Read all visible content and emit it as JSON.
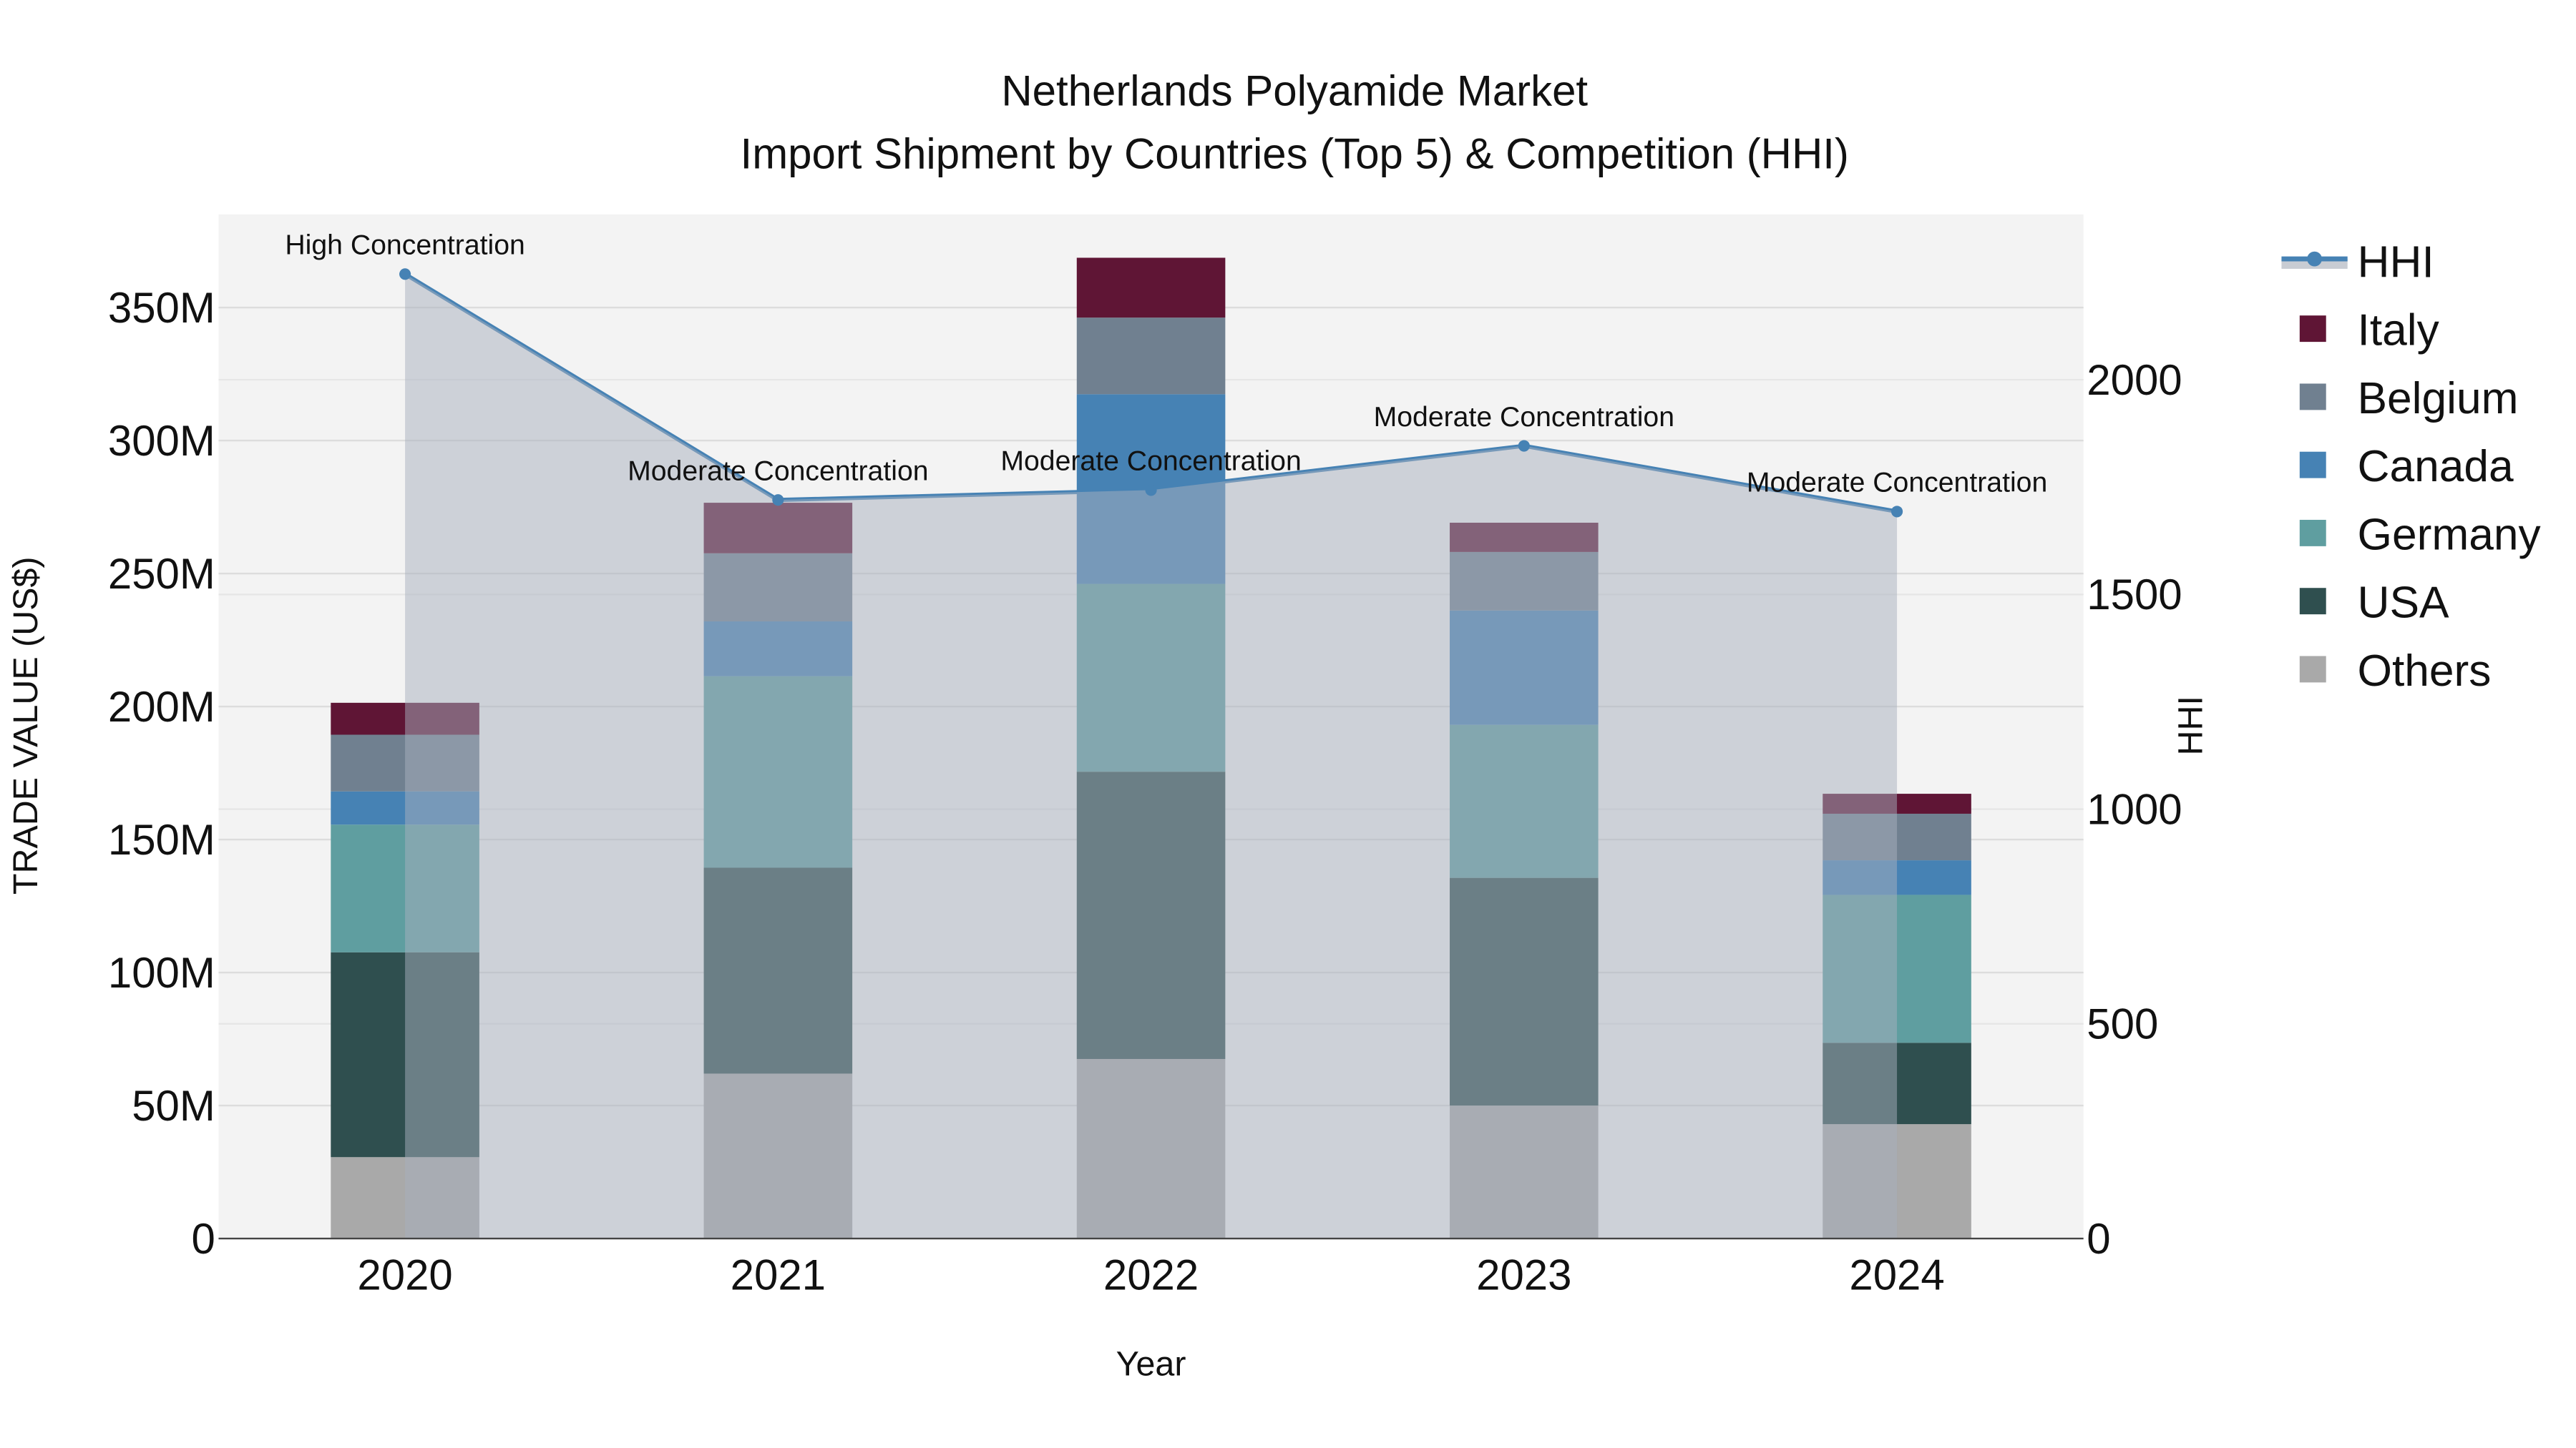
{
  "chart_data": {
    "type": "bar",
    "title": "Netherlands Polyamide Market",
    "subtitle": "Import Shipment by Countries (Top 5) & Competition (HHI)",
    "xlabel": "Year",
    "ylabel": "TRADE VALUE (US$)",
    "y2label": "HHI",
    "categories": [
      "2020",
      "2021",
      "2022",
      "2023",
      "2024"
    ],
    "ylim": [
      0,
      385
    ],
    "y_ticks": [
      0,
      50,
      100,
      150,
      200,
      250,
      300,
      350
    ],
    "y_tick_labels": [
      "0",
      "50M",
      "100M",
      "150M",
      "200M",
      "250M",
      "300M",
      "350M"
    ],
    "y2lim": [
      0,
      2385
    ],
    "y2_ticks": [
      0,
      500,
      1000,
      1500,
      2000
    ],
    "y2_tick_labels": [
      "0",
      "500",
      "1000",
      "1500",
      "2000"
    ],
    "grid": true,
    "legend_placement": "right",
    "stacked": true,
    "series": [
      {
        "name": "Others",
        "color": "#a9a9a9",
        "values": [
          30.6,
          62,
          67.5,
          50,
          43
        ]
      },
      {
        "name": "USA",
        "color": "#2f4f4f",
        "values": [
          77,
          77.4,
          108,
          85.6,
          30.6
        ]
      },
      {
        "name": "Germany",
        "color": "#5f9ea0",
        "values": [
          48,
          72,
          70.6,
          57.5,
          55.6
        ]
      },
      {
        "name": "Canada",
        "color": "#4682b4",
        "values": [
          12.5,
          20.6,
          71.3,
          43,
          13
        ]
      },
      {
        "name": "Belgium",
        "color": "#708090",
        "values": [
          21.3,
          25.6,
          28.8,
          22,
          17.5
        ]
      },
      {
        "name": "Italy",
        "color": "#5f1535",
        "values": [
          12,
          19,
          22.5,
          11,
          7.5
        ]
      }
    ],
    "hhi": {
      "name": "HHI",
      "color": "#4682b4",
      "values": [
        2246,
        1720,
        1743,
        1846,
        1693
      ],
      "annotations": [
        "High Concentration",
        "Moderate Concentration",
        "Moderate Concentration",
        "Moderate Concentration",
        "Moderate Concentration"
      ]
    },
    "legend_order": [
      "HHI",
      "Italy",
      "Belgium",
      "Canada",
      "Germany",
      "USA",
      "Others"
    ]
  }
}
